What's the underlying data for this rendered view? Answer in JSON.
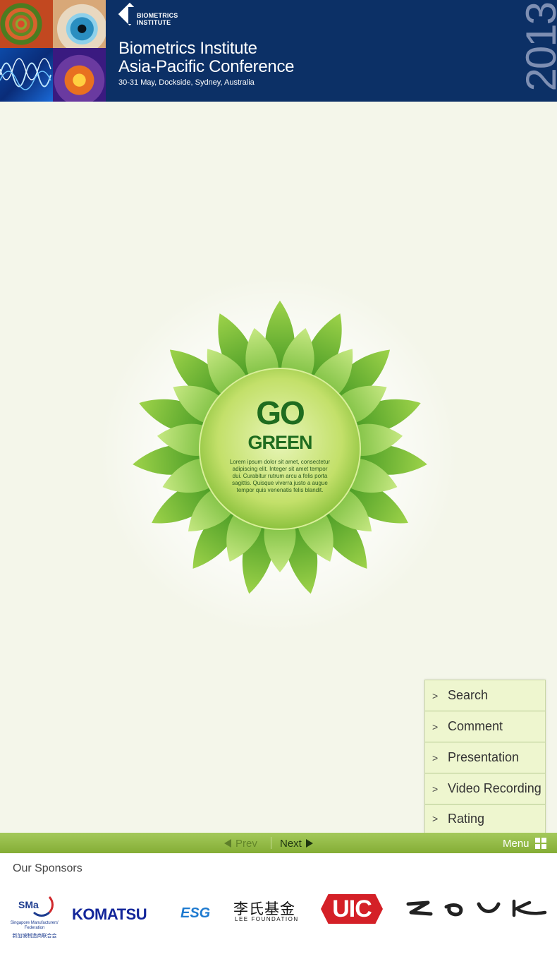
{
  "header": {
    "logo_line1": "BIOMETRICS",
    "logo_line2": "INSTITUTE",
    "title_line1": "Biometrics Institute",
    "title_line2": "Asia-Pacific Conference",
    "subtitle": "30-31 May, Dockside, Sydney, Australia",
    "year": "2013"
  },
  "slide": {
    "go": "GO",
    "green": "GREEN",
    "lorem": "Lorem ipsum dolor sit amet, consectetur adipiscing elit. Integer sit amet tempor dui. Curabitur rutrum arcu a felis porta sagittis. Quisque viverra justo a augue tempor quis venenatis felis blandit."
  },
  "side_menu": {
    "items": [
      {
        "label": "Search",
        "arrow": ">"
      },
      {
        "label": "Comment",
        "arrow": ">"
      },
      {
        "label": "Presentation",
        "arrow": ">"
      },
      {
        "label": "Video Recording",
        "arrow": ">"
      },
      {
        "label": "Rating",
        "arrow": ">"
      }
    ]
  },
  "navbar": {
    "prev_label": "Prev",
    "next_label": "Next",
    "menu_label": "Menu"
  },
  "sponsors": {
    "title": "Our Sponsors",
    "sma": {
      "abbr": "SMa",
      "name": "Singapore Manufacturers' Federation",
      "chinese": "新加坡制造商联合会"
    },
    "komatsu": "KOMATSU",
    "esg": "ESG",
    "lee_cn": "李氏基金",
    "lee_en": "LEE FOUNDATION",
    "uic": "UIC",
    "zouk": "ZOUK"
  },
  "colors": {
    "header_bg": "#0c3066",
    "content_bg": "#f4f6ea",
    "nav_green": "#94bb45",
    "menu_bg": "#eef6cf",
    "go_green": "#1f6c1f"
  },
  "icons": [
    "triangle-left-icon",
    "triangle-right-icon",
    "grid-menu-icon",
    "chevron-right-icon"
  ]
}
